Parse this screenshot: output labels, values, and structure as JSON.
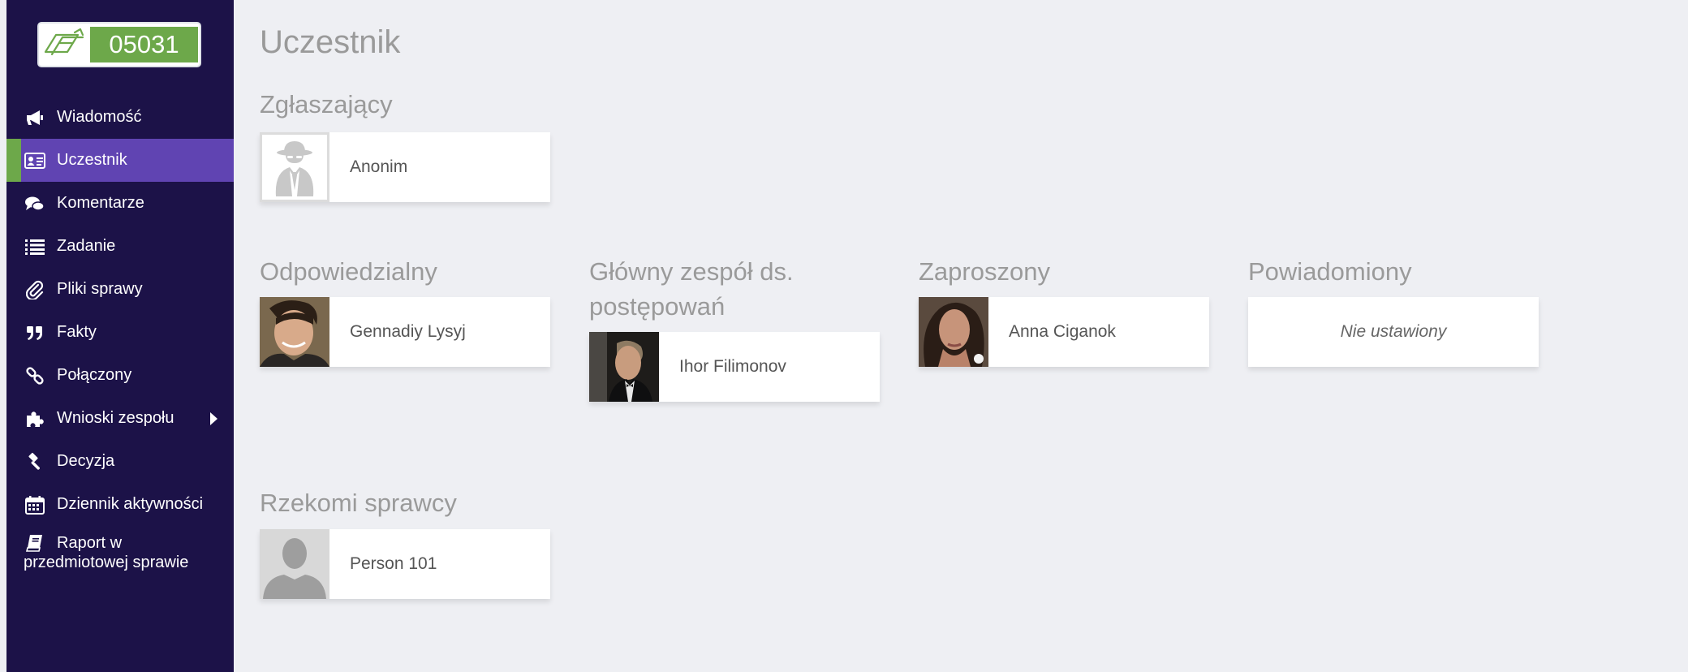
{
  "case": {
    "number": "05031"
  },
  "sidebar": {
    "items": [
      {
        "label": "Wiadomość",
        "icon": "megaphone-icon"
      },
      {
        "label": "Uczestnik",
        "icon": "id-card-icon",
        "active": true
      },
      {
        "label": "Komentarze",
        "icon": "comments-icon"
      },
      {
        "label": "Zadanie",
        "icon": "list-icon"
      },
      {
        "label": "Pliki sprawy",
        "icon": "paperclip-icon"
      },
      {
        "label": "Fakty",
        "icon": "quote-icon"
      },
      {
        "label": "Połączony",
        "icon": "link-icon"
      },
      {
        "label": "Wnioski zespołu",
        "icon": "puzzle-icon",
        "has_submenu": true
      },
      {
        "label": "Decyzja",
        "icon": "gavel-icon"
      },
      {
        "label": "Dziennik aktywności",
        "icon": "calendar-icon"
      },
      {
        "label_line1": "Raport w",
        "label_line2": "przedmiotowej sprawie",
        "icon": "book-icon"
      }
    ]
  },
  "page": {
    "title": "Uczestnik",
    "sections": {
      "reporter": {
        "heading": "Zgłaszający",
        "person": "Anonim",
        "avatar": "anonymous-icon"
      },
      "responsible": {
        "heading": "Odpowiedzialny",
        "person": "Gennadiy Lysyj",
        "avatar": "photo"
      },
      "team": {
        "heading_line1": "Główny zespół ds.",
        "heading_line2": "postępowań",
        "person": "Ihor Filimonov",
        "avatar": "photo"
      },
      "invited": {
        "heading": "Zaproszony",
        "person": "Anna Ciganok",
        "avatar": "photo"
      },
      "notified": {
        "heading": "Powiadomiony",
        "empty_text": "Nie ustawiony"
      },
      "perpetrators": {
        "heading": "Rzekomi sprawcy",
        "person": "Person 101",
        "avatar": "silhouette-icon"
      }
    }
  },
  "colors": {
    "sidebar_bg": "#1c1248",
    "active_bg": "#6044b2",
    "accent_green": "#6da84a",
    "page_bg": "#eeeff3"
  }
}
